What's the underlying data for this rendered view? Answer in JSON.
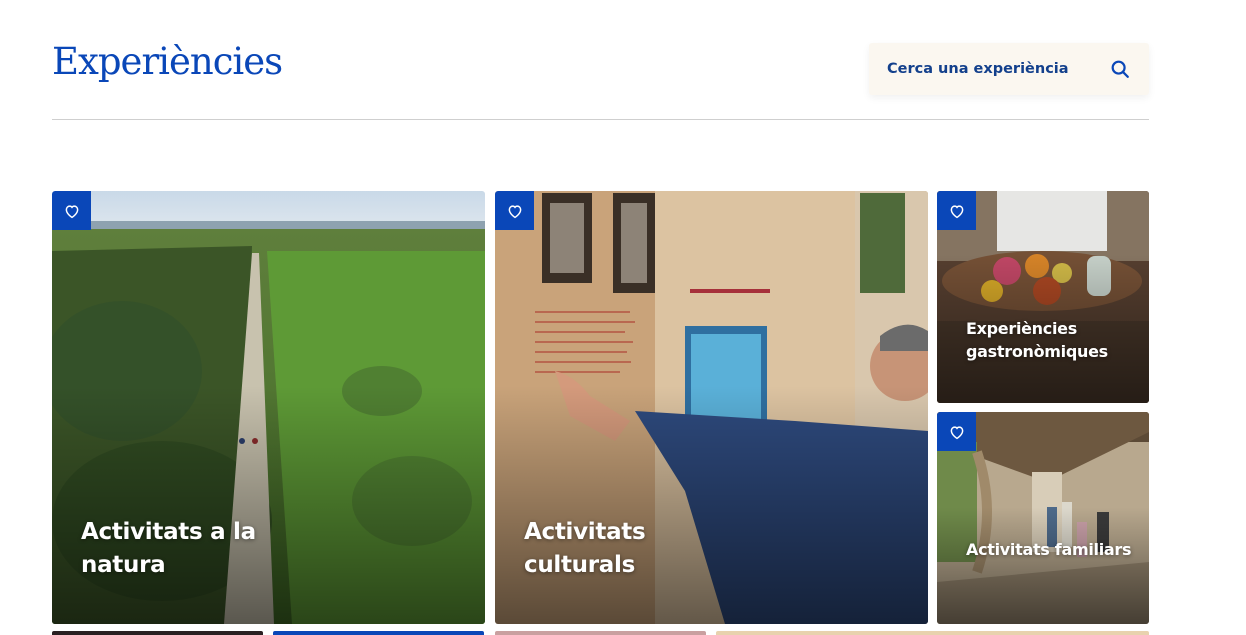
{
  "header": {
    "title": "Experiències",
    "search": {
      "label": "Cerca una experiència",
      "icon": "search-icon"
    }
  },
  "colors": {
    "brand_blue": "#0a47b8",
    "search_bg": "#fbf7f0",
    "divider": "#cfcfcf"
  },
  "cards": [
    {
      "title": "Activitats a la natura",
      "favorite_icon": "heart-icon"
    },
    {
      "title": "Activitats culturals",
      "favorite_icon": "heart-icon"
    },
    {
      "title": "Experiències gastronòmiques",
      "favorite_icon": "heart-icon"
    },
    {
      "title": "Activitats familiars",
      "favorite_icon": "heart-icon"
    }
  ]
}
